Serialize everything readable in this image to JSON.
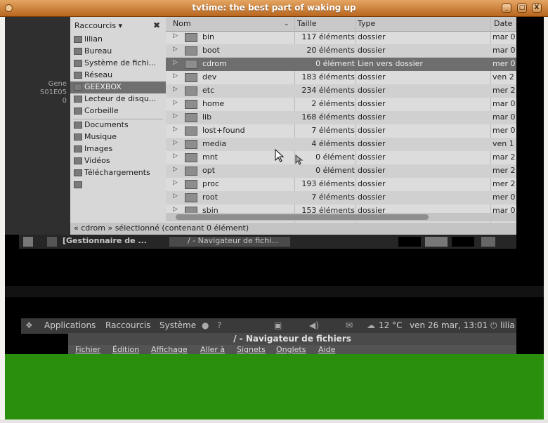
{
  "window": {
    "title": "tvtime: the best part of waking up",
    "minimize": "_",
    "maximize": "□",
    "close": "X"
  },
  "left_text": {
    "line1": "Gene",
    "line2": "S01E05",
    "line3": "0"
  },
  "sidebar": {
    "header": "Raccourcis",
    "items": [
      {
        "label": "lilian"
      },
      {
        "label": "Bureau"
      },
      {
        "label": "Système de fichi..."
      },
      {
        "label": "Réseau"
      },
      {
        "label": "GEEXBOX"
      },
      {
        "label": "Lecteur de disqu..."
      },
      {
        "label": "Corbeille"
      },
      {
        "label": "Documents"
      },
      {
        "label": "Musique"
      },
      {
        "label": "Images"
      },
      {
        "label": "Vidéos"
      },
      {
        "label": "Téléchargements"
      }
    ]
  },
  "columns": {
    "name": "Nom",
    "size": "Taille",
    "type": "Type",
    "date": "Date"
  },
  "rows": [
    {
      "name": "bin",
      "size": "117 éléments",
      "type": "dossier",
      "date": "mar 0"
    },
    {
      "name": "boot",
      "size": "20 éléments",
      "type": "dossier",
      "date": "mar 0"
    },
    {
      "name": "cdrom",
      "size": "0 élément",
      "type": "Lien vers dossier",
      "date": "mer 0"
    },
    {
      "name": "dev",
      "size": "183 éléments",
      "type": "dossier",
      "date": "ven 2"
    },
    {
      "name": "etc",
      "size": "234 éléments",
      "type": "dossier",
      "date": "mer 2"
    },
    {
      "name": "home",
      "size": "2 éléments",
      "type": "dossier",
      "date": "mar 0"
    },
    {
      "name": "lib",
      "size": "168 éléments",
      "type": "dossier",
      "date": "mar 0"
    },
    {
      "name": "lost+found",
      "size": "7 éléments",
      "type": "dossier",
      "date": "mer 0"
    },
    {
      "name": "media",
      "size": "4 éléments",
      "type": "dossier",
      "date": "ven 1"
    },
    {
      "name": "mnt",
      "size": "0 élément",
      "type": "dossier",
      "date": "mar 2"
    },
    {
      "name": "opt",
      "size": "0 élément",
      "type": "dossier",
      "date": "mer 2"
    },
    {
      "name": "proc",
      "size": "193 éléments",
      "type": "dossier",
      "date": "mer 2"
    },
    {
      "name": "root",
      "size": "7 éléments",
      "type": "dossier",
      "date": "mer 0"
    },
    {
      "name": "sbin",
      "size": "153 éléments",
      "type": "dossier",
      "date": "mar 0"
    }
  ],
  "status": "« cdrom » sélectionné (contenant 0 élément)",
  "taskbar": {
    "item1": "[Gestionnaire de ...",
    "item2": "/ - Navigateur de fichi..."
  },
  "panel": {
    "applications": "Applications",
    "raccourcis": "Raccourcis",
    "systeme": "Système",
    "temp": "12 °C",
    "datetime": "ven 26 mar, 13:01",
    "user": "lilia"
  },
  "window2": {
    "title": "/ - Navigateur de fichiers",
    "menu": [
      "Fichier",
      "Édition",
      "Affichage",
      "Aller à",
      "Signets",
      "Onglets",
      "Aide"
    ]
  }
}
